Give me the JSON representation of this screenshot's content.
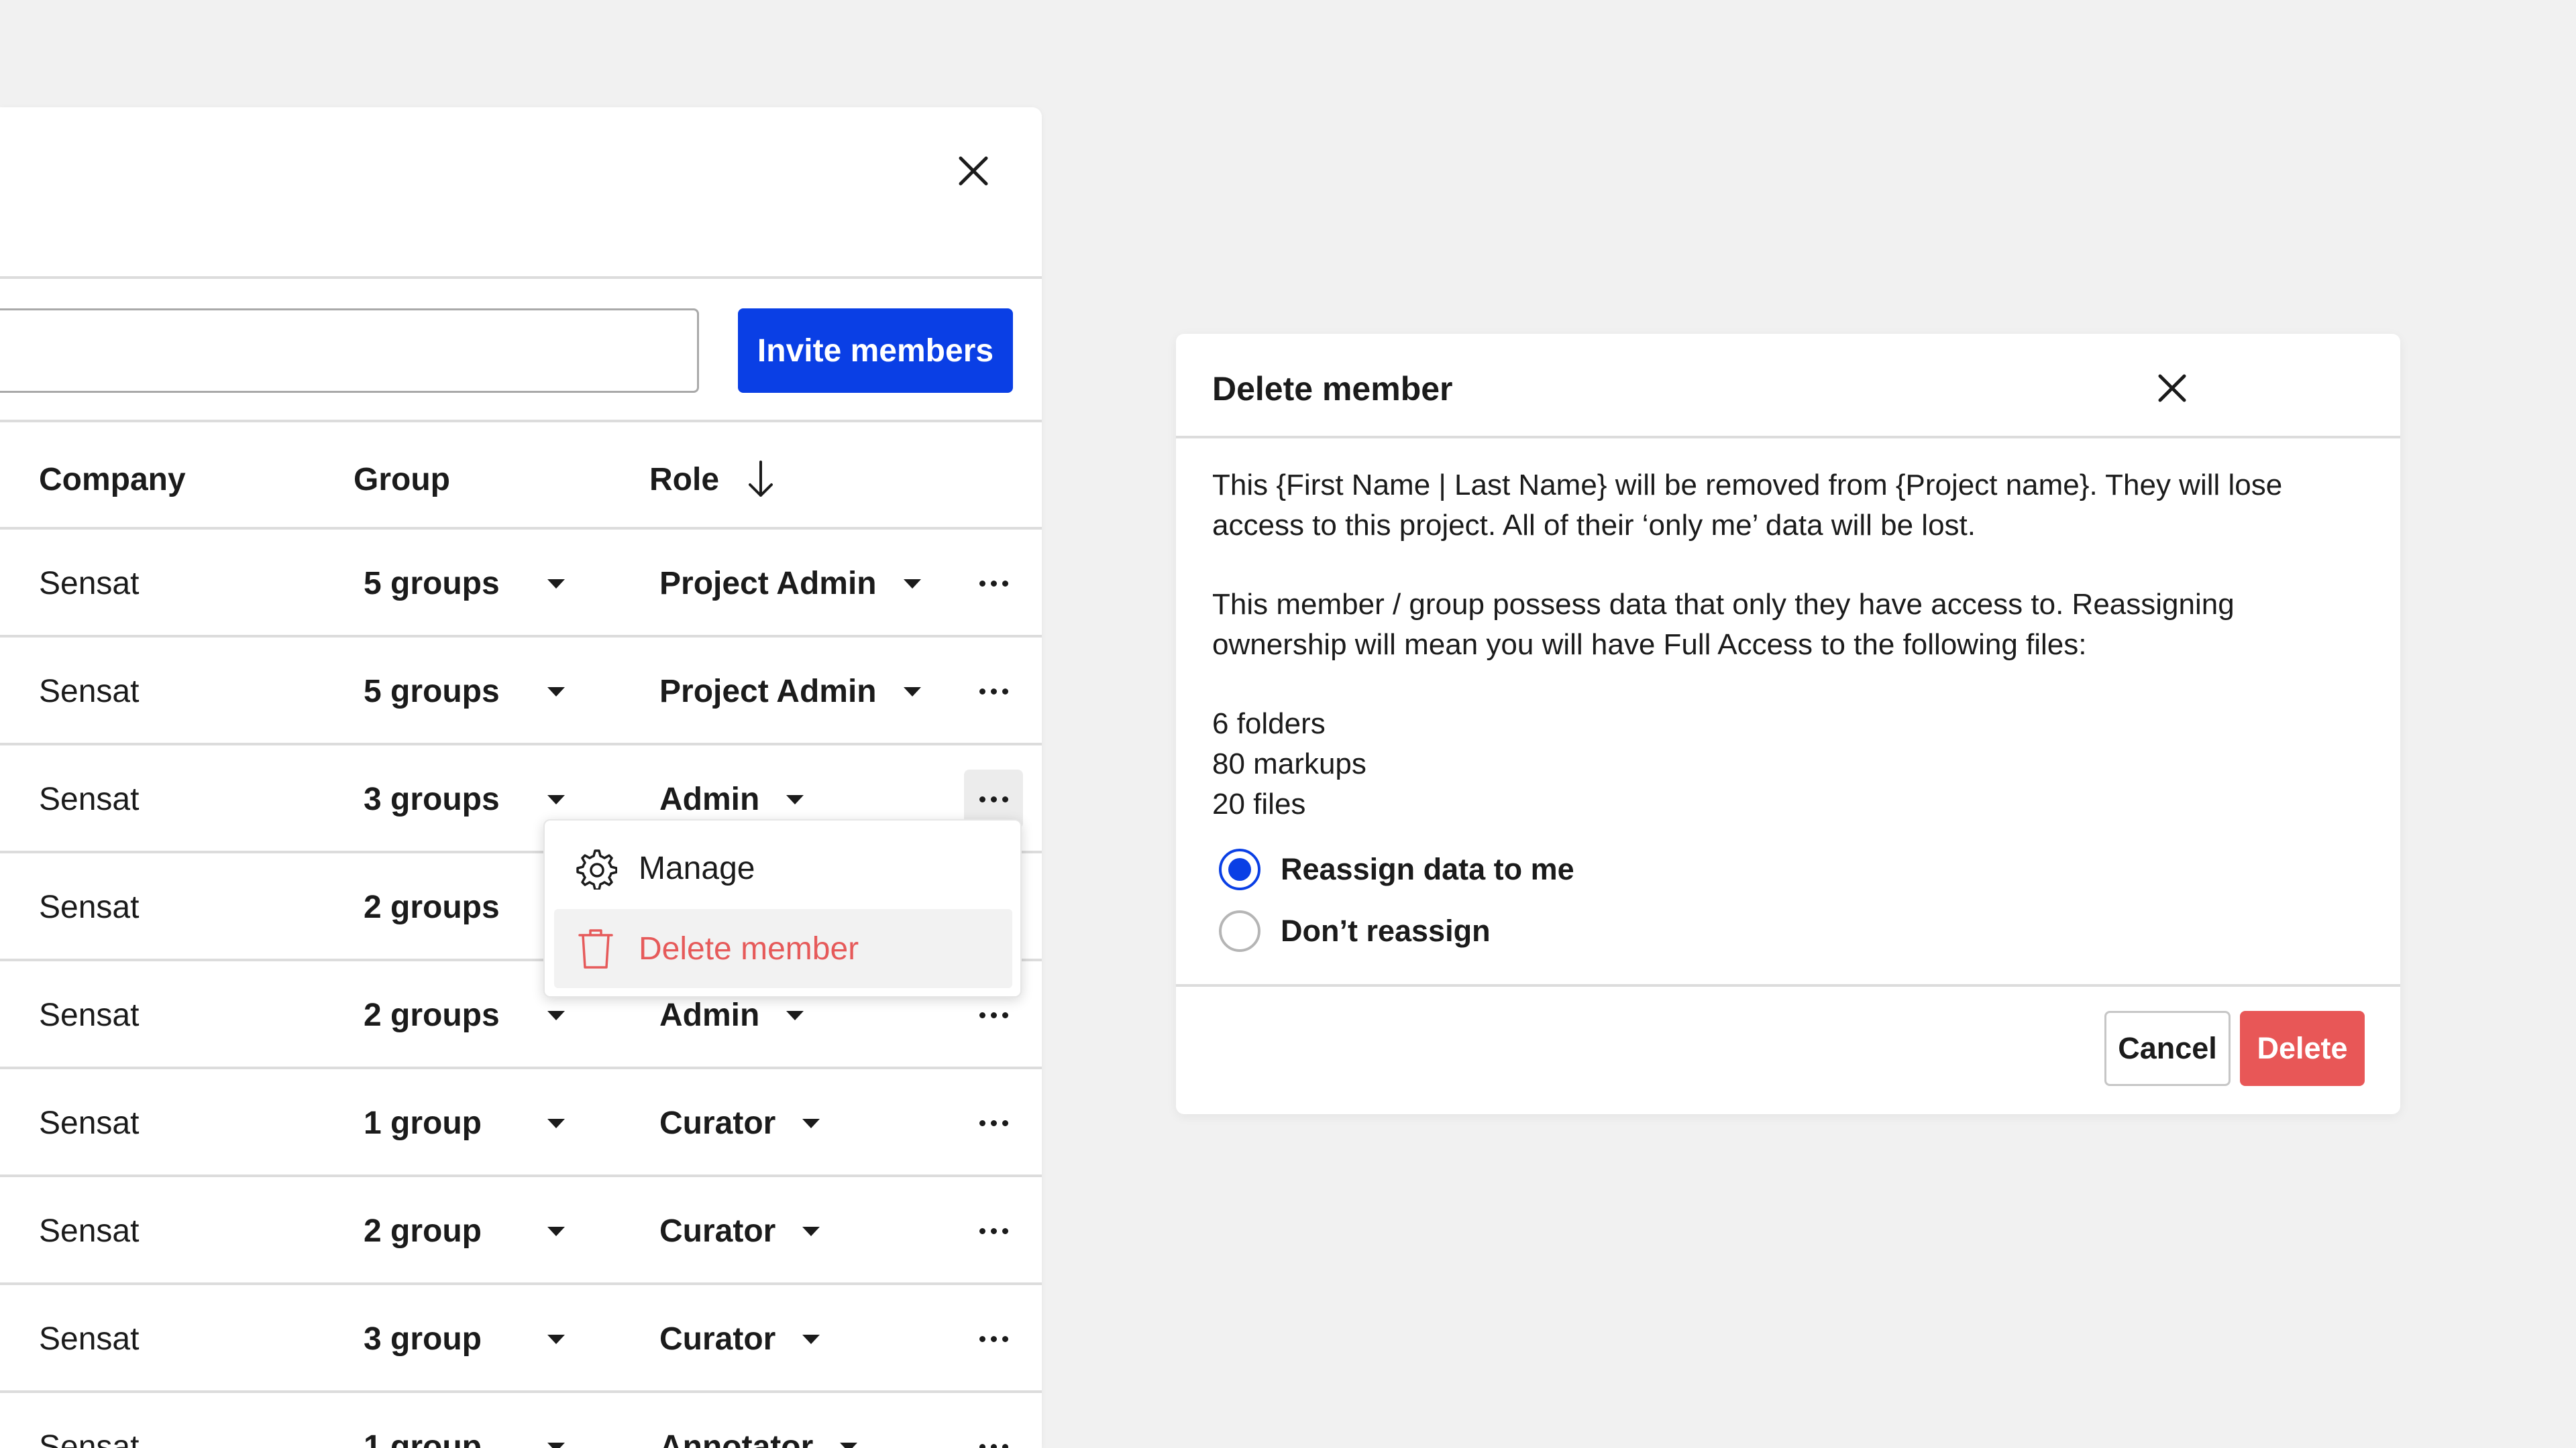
{
  "toolbar": {
    "search_placeholder": "",
    "invite_label": "Invite members"
  },
  "table": {
    "headers": {
      "company": "Company",
      "group": "Group",
      "role": "Role"
    },
    "rows": [
      {
        "company": "Sensat",
        "group": "5 groups",
        "role": "Project Admin"
      },
      {
        "company": "Sensat",
        "group": "5 groups",
        "role": "Project Admin"
      },
      {
        "company": "Sensat",
        "group": "3 groups",
        "role": "Admin"
      },
      {
        "company": "Sensat",
        "group": "2 groups",
        "role": ""
      },
      {
        "company": "Sensat",
        "group": "2 groups",
        "role": "Admin"
      },
      {
        "company": "Sensat",
        "group": "1 group",
        "role": "Curator"
      },
      {
        "company": "Sensat",
        "group": "2 group",
        "role": "Curator"
      },
      {
        "company": "Sensat",
        "group": "3 group",
        "role": "Curator"
      },
      {
        "company": "Sensat",
        "group": "1 group",
        "role": "Annotator"
      }
    ]
  },
  "context_menu": {
    "manage": "Manage",
    "delete": "Delete member"
  },
  "dialog": {
    "title": "Delete member",
    "message_1": "This {First Name | Last Name} will be removed from {Project name}. They will lose access to this project. All of their ‘only me’ data will be lost.",
    "message_2": "This member / group possess data that only they have access to. Reassigning ownership will mean you will have Full Access to the following files:",
    "files": [
      "6 folders",
      "80 markups",
      "20 files"
    ],
    "options": [
      {
        "label": "Reassign data to me",
        "checked": true
      },
      {
        "label": "Don’t reassign",
        "checked": false
      }
    ],
    "cancel_label": "Cancel",
    "delete_label": "Delete"
  },
  "colors": {
    "primary": "#0a3fe5",
    "danger": "#e85757",
    "background": "#f1f1f1"
  }
}
